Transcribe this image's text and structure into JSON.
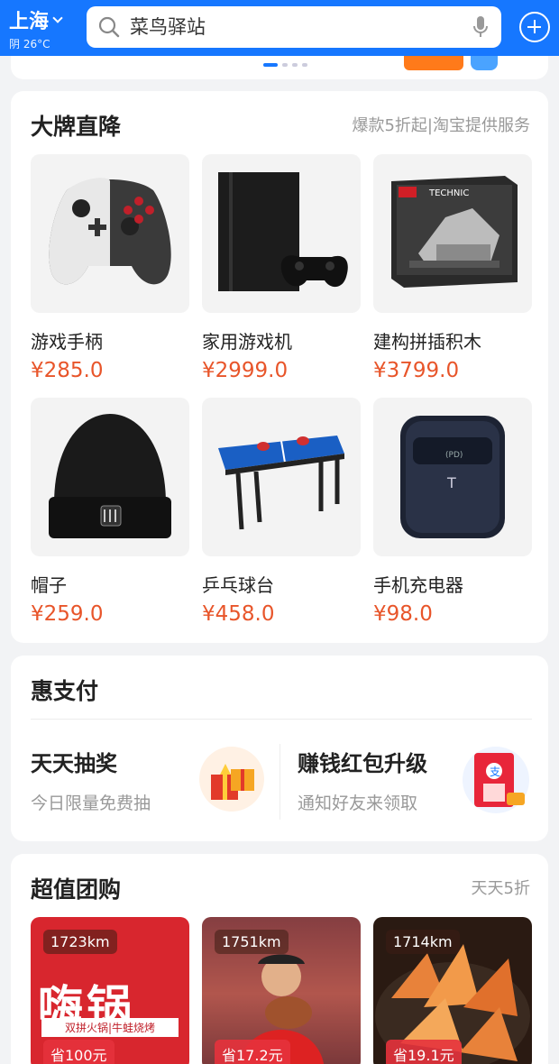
{
  "header": {
    "city": "上海",
    "weather": "阴 26°C",
    "search_placeholder": "菜鸟驿站"
  },
  "colors": {
    "brand_blue": "#1677ff",
    "price_red": "#e8552a",
    "background": "#f2f3f5"
  },
  "brand_section": {
    "title": "大牌直降",
    "subtitle": "爆款5折起|淘宝提供服务",
    "products": [
      {
        "name": "游戏手柄",
        "price": "¥285.0",
        "icon": "gamepad-image"
      },
      {
        "name": "家用游戏机",
        "price": "¥2999.0",
        "icon": "game-console-image"
      },
      {
        "name": "建构拼插积木",
        "price": "¥3799.0",
        "icon": "building-blocks-image"
      },
      {
        "name": "帽子",
        "price": "¥259.0",
        "icon": "beanie-hat-image"
      },
      {
        "name": "乒乓球台",
        "price": "¥458.0",
        "icon": "ping-pong-table-image"
      },
      {
        "name": "手机充电器",
        "price": "¥98.0",
        "icon": "phone-charger-image"
      }
    ]
  },
  "hui_section": {
    "title": "惠支付",
    "promos": [
      {
        "title": "天天抽奖",
        "subtitle": "今日限量免费抽",
        "icon": "gift-box-icon"
      },
      {
        "title": "赚钱红包升级",
        "subtitle": "通知好友来领取",
        "icon": "red-packet-icon"
      }
    ]
  },
  "group_section": {
    "title": "超值团购",
    "subtitle": "天天5折",
    "items": [
      {
        "distance": "1723km",
        "save": "省100元",
        "sign_text": "嗨锅",
        "sign_sub": "双拼火锅|牛蛙烧烤"
      },
      {
        "distance": "1751km",
        "save": "省17.2元"
      },
      {
        "distance": "1714km",
        "save": "省19.1元"
      }
    ]
  }
}
